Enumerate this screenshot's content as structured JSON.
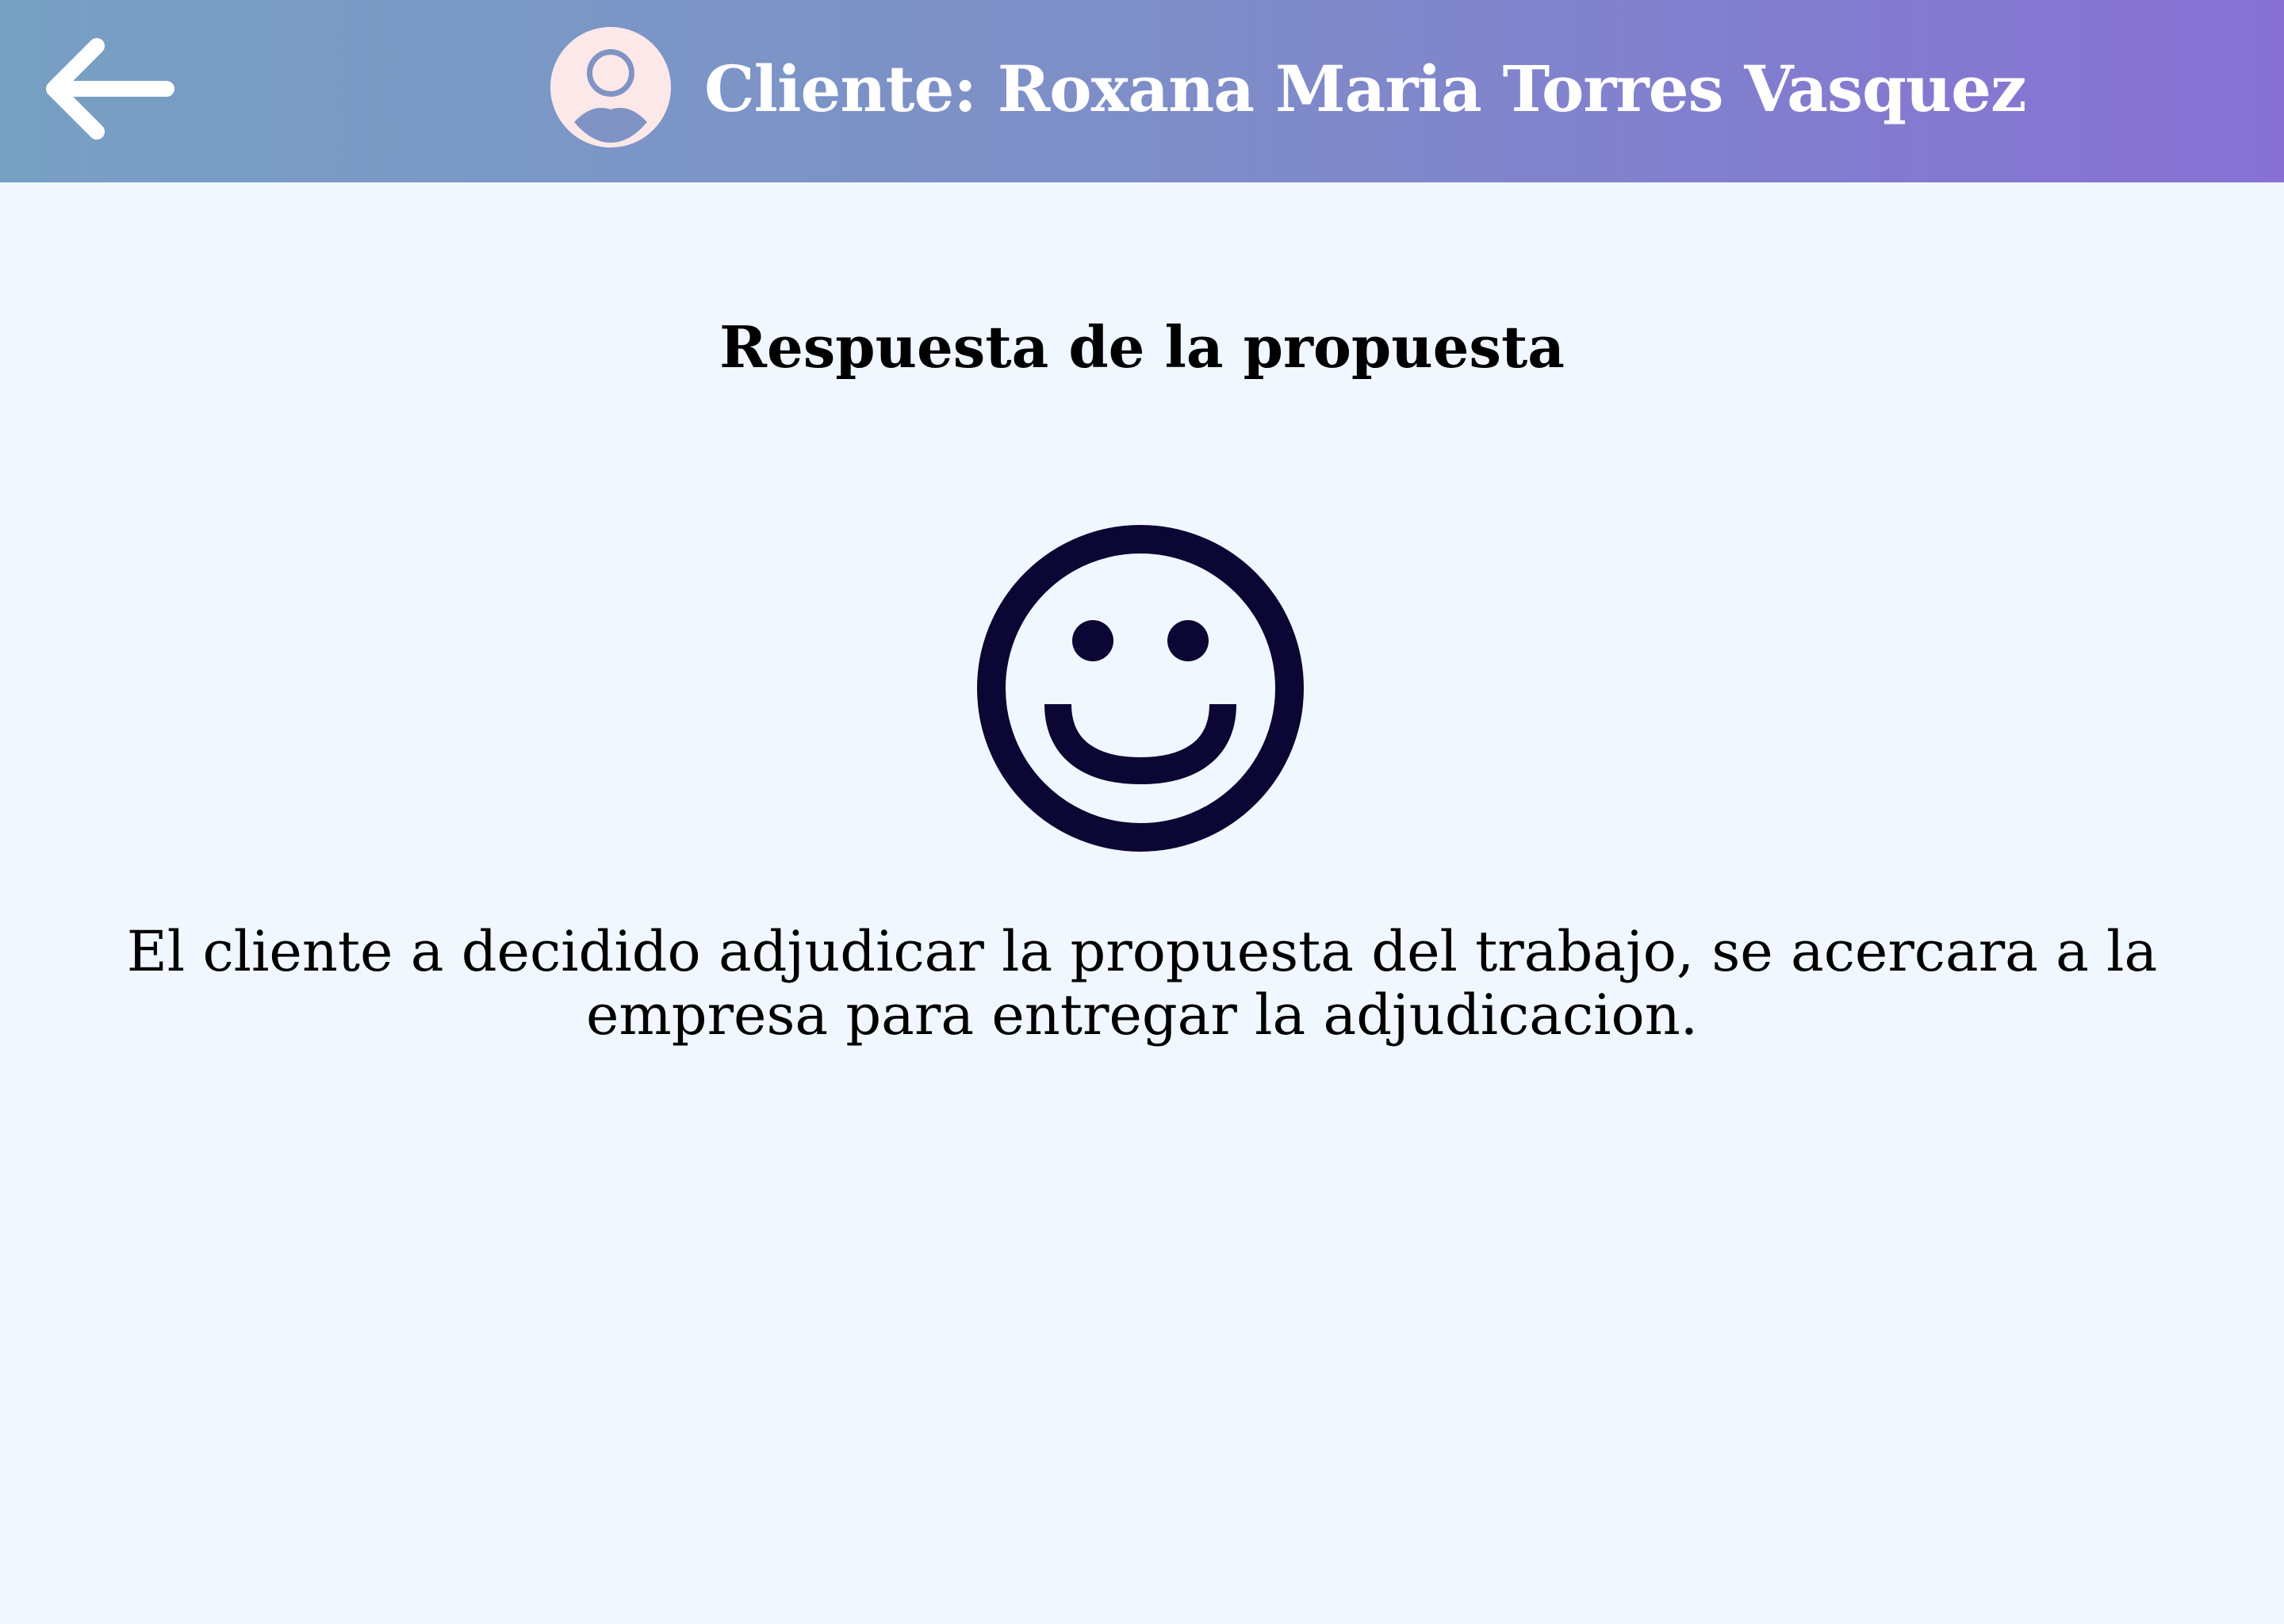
{
  "header": {
    "client_title": "Cliente: Roxana Maria Torres Vasquez",
    "back_icon": "arrow-left-icon",
    "avatar_icon": "user-avatar-icon",
    "gradient_colors": [
      "#77a0c3",
      "#8670d4"
    ]
  },
  "main": {
    "section_title": "Respuesta de la propuesta",
    "status_icon": "smiley-face-icon",
    "status_icon_color": "#0b0633",
    "message": "El cliente a decidido adjudicar la propuesta del trabajo, se acercara a la empresa para entregar la adjudicacion."
  },
  "colors": {
    "background": "#f0f7ff",
    "header_text": "#ffffff",
    "body_text": "#000000"
  }
}
